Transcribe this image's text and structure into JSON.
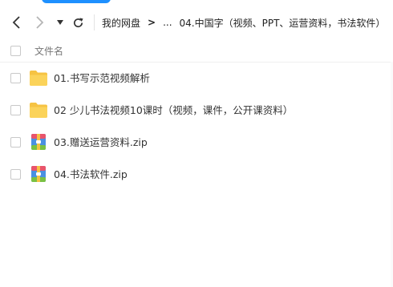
{
  "nav": {
    "back_icon": "chevron-left-icon",
    "forward_icon": "chevron-right-icon",
    "dropdown_icon": "caret-down-icon",
    "refresh_icon": "refresh-icon"
  },
  "breadcrumb": {
    "root": "我的网盘",
    "ellipsis": "...",
    "current": "04.中国字（视频、PPT、运营资料，书法软件）"
  },
  "list": {
    "column_name": "文件名",
    "files": [
      {
        "name": "01.书写示范视频解析",
        "icon": "folder-icon"
      },
      {
        "name": "02 少儿书法视频10课时（视频，课件，公开课资料）",
        "icon": "folder-icon"
      },
      {
        "name": "03.赠送运营资料.zip",
        "icon": "archive-icon"
      },
      {
        "name": "04.书法软件.zip",
        "icon": "archive-icon"
      }
    ]
  },
  "colors": {
    "accent": "#1e90ff",
    "folder": "#f6c343",
    "archive_red": "#e9546b",
    "archive_blue": "#4a90e2",
    "archive_green": "#7ac143"
  }
}
